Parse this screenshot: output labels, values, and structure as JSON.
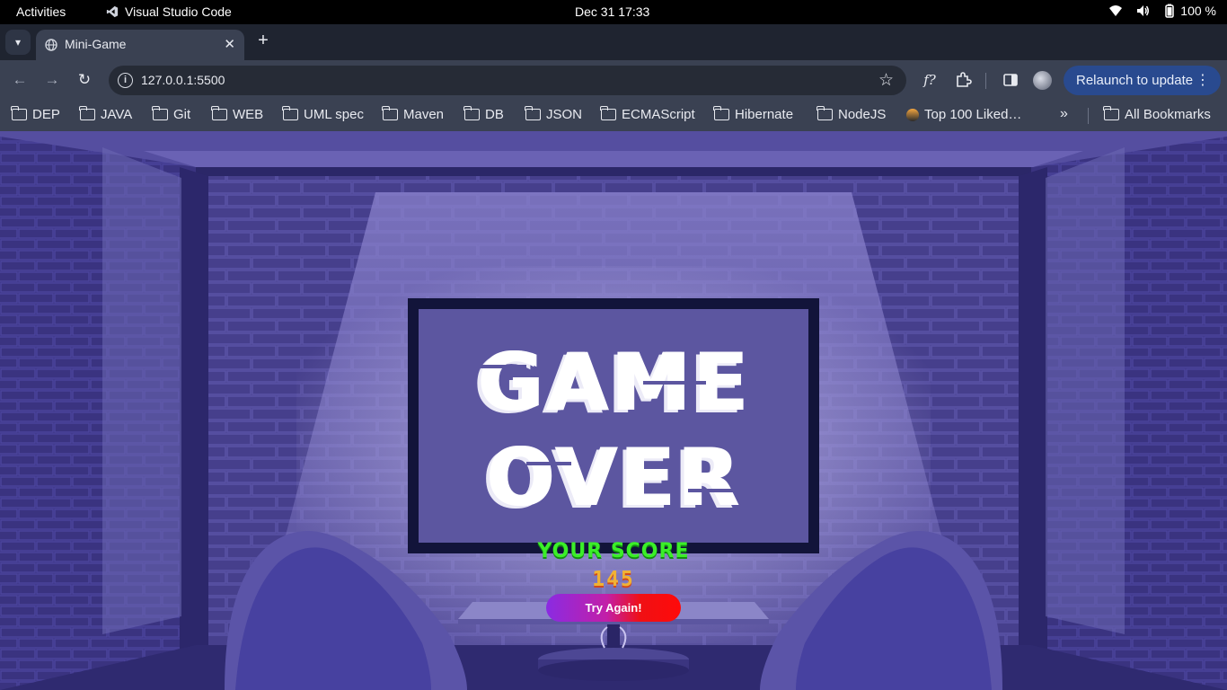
{
  "system_bar": {
    "activities": "Activities",
    "app_name": "Visual Studio Code",
    "datetime": "Dec 31  17:33",
    "battery": "100 %"
  },
  "browser": {
    "tab": {
      "title": "Mini-Game",
      "close": "✕"
    },
    "new_tab": "+",
    "url": "127.0.0.1:5500",
    "relaunch_label": "Relaunch to update",
    "bookmarks": [
      "DEP",
      "JAVA",
      "Git",
      "WEB",
      "UML spec",
      "Maven",
      "DB",
      "JSON",
      "ECMAScript",
      "Hibernate",
      "NodeJS",
      "Top 100 Liked…"
    ],
    "all_bookmarks": "All Bookmarks",
    "icons": {
      "back": "arrow-left-icon",
      "forward": "arrow-right-icon",
      "reload": "reload-icon",
      "site_info": "info-icon",
      "bookmark_star": "star-icon",
      "extensions": "puzzle-icon",
      "side_panel": "side-panel-icon",
      "more": "kebab-menu-icon"
    }
  },
  "game": {
    "title_line1": "GAME",
    "title_line2": "OVER",
    "score_label": "YOUR SCORE",
    "score_value": "145",
    "try_again": "Try Again!",
    "colors": {
      "background": "#3b3479",
      "score_label": "#3bef28",
      "score_value": "#f0b234",
      "button_start": "#8a2be2",
      "button_end": "#ff0a0a"
    }
  }
}
